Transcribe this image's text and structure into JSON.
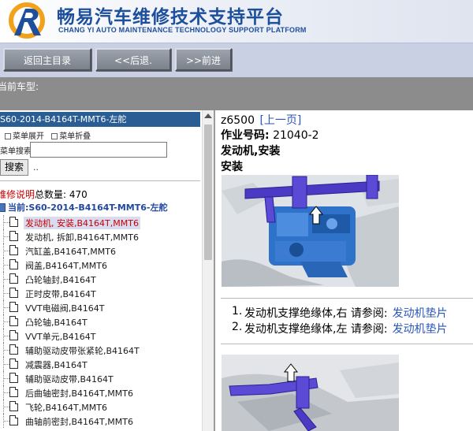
{
  "header": {
    "title_cn": "畅易汽车维修技术支持平台",
    "title_en": "CHANG YI AUTO MAINTENANCE TECHNOLOGY SUPPORT PLATFORM"
  },
  "nav": {
    "home": "返回主目录",
    "back": "<<后退.",
    "forward": ">>前进"
  },
  "car_bar": {
    "label": "当前车型:"
  },
  "left": {
    "title": "S60-2014-B4164T-MMT6-左舵",
    "menu_expand": "菜单展开",
    "menu_collapse": "菜单折叠",
    "search_label": "菜单搜索",
    "search_button": "搜索",
    "search_dots": "..",
    "maint_label": "维修说明",
    "maint_count_text": "总数量:",
    "maint_count": "470",
    "current": "当前:S60-2014-B4164T-MMT6-左舵",
    "tree": [
      "发动机, 安装,B4164T,MMT6",
      "发动机, 拆卸,B4164T,MMT6",
      "汽缸盖,B4164T,MMT6",
      "阀盖,B4164T,MMT6",
      "凸轮轴封,B4164T",
      "正时皮带,B4164T",
      "VVT电磁阀,B4164T",
      "凸轮轴,B4164T",
      "VVT单元,B4164T",
      "辅助驱动皮带张紧轮,B4164T",
      "减震器,B4164T",
      "辅助驱动皮带,B4164T",
      "后曲轴密封,B4164T,MMT6",
      "飞轮,B4164T,MMT6",
      "曲轴前密封,B4164T,MMT6"
    ]
  },
  "right": {
    "page_code": "z6500",
    "prev_page": "[上一页]",
    "job_label": "作业号码:",
    "job_no": "21040-2",
    "title": "发动机,安装",
    "subtitle": "安装",
    "steps": [
      {
        "num": "1.",
        "text": "发动机支撑绝缘体,右 请参阅:",
        "link": "发动机垫片"
      },
      {
        "num": "2.",
        "text": "发动机支撑绝缘体,左 请参阅:",
        "link": "发动机垫片"
      }
    ]
  },
  "colors": {
    "brand_blue": "#1d4f9c",
    "title_bar": "#2a5d93",
    "link": "#2a56b8",
    "maint_red": "#cc0000",
    "car_bar_gray": "#8c8c8c"
  }
}
